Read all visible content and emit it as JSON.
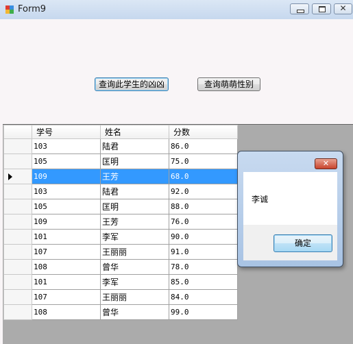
{
  "window": {
    "title": "Form9"
  },
  "buttons": {
    "query_student": "查询此学生的凶凶",
    "query_gender": "查询萌萌性别"
  },
  "grid": {
    "columns": [
      "学号",
      "姓名",
      "分数"
    ],
    "selected_row_index": 2,
    "rows": [
      {
        "id": "103",
        "name": "陆君",
        "score": "86.0"
      },
      {
        "id": "105",
        "name": "匡明",
        "score": "75.0"
      },
      {
        "id": "109",
        "name": "王芳",
        "score": "68.0"
      },
      {
        "id": "103",
        "name": "陆君",
        "score": "92.0"
      },
      {
        "id": "105",
        "name": "匡明",
        "score": "88.0"
      },
      {
        "id": "109",
        "name": "王芳",
        "score": "76.0"
      },
      {
        "id": "101",
        "name": "李军",
        "score": "90.0"
      },
      {
        "id": "107",
        "name": "王丽丽",
        "score": "91.0"
      },
      {
        "id": "108",
        "name": "曾华",
        "score": "78.0"
      },
      {
        "id": "101",
        "name": "李军",
        "score": "85.0"
      },
      {
        "id": "107",
        "name": "王丽丽",
        "score": "84.0"
      },
      {
        "id": "108",
        "name": "曾华",
        "score": "99.0"
      }
    ]
  },
  "messagebox": {
    "message": "李诚",
    "ok_label": "确定",
    "close_glyph": "✕"
  }
}
